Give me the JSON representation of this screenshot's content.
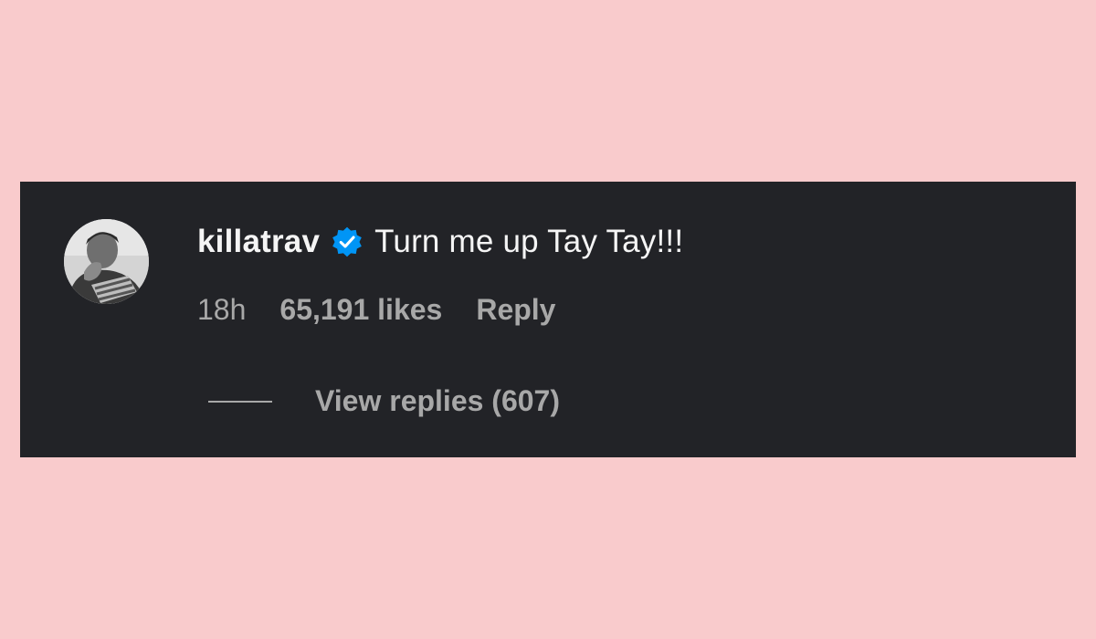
{
  "comment": {
    "username": "killatrav",
    "verified": true,
    "text": "Turn me up Tay Tay!!!",
    "time": "18h",
    "likes": "65,191 likes",
    "reply_label": "Reply",
    "view_replies_label": "View replies (607)"
  },
  "colors": {
    "page_background": "#f9cbcc",
    "card_background": "#222327",
    "primary_text": "#f5f5f5",
    "secondary_text": "#a8a8a8",
    "verified_badge": "#0095f6"
  },
  "icons": {
    "verified": "verified-badge-icon",
    "avatar": "user-avatar"
  }
}
